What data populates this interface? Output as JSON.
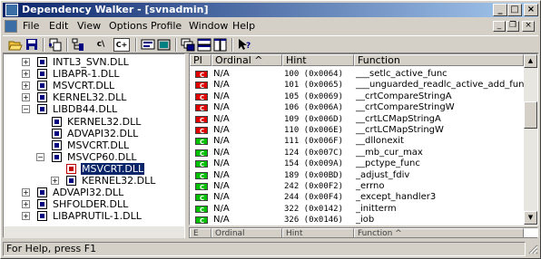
{
  "window": {
    "title": "Dependency Walker - [svnadmin]",
    "min": "_",
    "max": "□",
    "close": "×"
  },
  "menubar": {
    "items": [
      "File",
      "Edit",
      "View",
      "Options",
      "Profile",
      "Window",
      "Help"
    ],
    "mdi_min": "_",
    "mdi_restore": "❐",
    "mdi_close": "×"
  },
  "toolbar": {
    "c_label": "c\\",
    "cpp_label": "C+"
  },
  "tree": {
    "items": [
      {
        "label": "INTL3_SVN.DLL",
        "expander": "+",
        "depth": 0,
        "style": "normal",
        "selected": false
      },
      {
        "label": "LIBAPR-1.DLL",
        "expander": "+",
        "depth": 0,
        "style": "normal",
        "selected": false
      },
      {
        "label": "MSVCRT.DLL",
        "expander": "+",
        "depth": 0,
        "style": "normal",
        "selected": false
      },
      {
        "label": "KERNEL32.DLL",
        "expander": "+",
        "depth": 0,
        "style": "normal",
        "selected": false
      },
      {
        "label": "LIBDB44.DLL",
        "expander": "−",
        "depth": 0,
        "style": "normal",
        "selected": false
      },
      {
        "label": "KERNEL32.DLL",
        "expander": "",
        "depth": 1,
        "style": "normal",
        "selected": false
      },
      {
        "label": "ADVAPI32.DLL",
        "expander": "",
        "depth": 1,
        "style": "normal",
        "selected": false
      },
      {
        "label": "MSVCRT.DLL",
        "expander": "",
        "depth": 1,
        "style": "normal",
        "selected": false
      },
      {
        "label": "MSVCP60.DLL",
        "expander": "−",
        "depth": 1,
        "style": "normal",
        "selected": false
      },
      {
        "label": "MSVCRT.DLL",
        "expander": "",
        "depth": 2,
        "style": "red",
        "selected": true
      },
      {
        "label": "KERNEL32.DLL",
        "expander": "+",
        "depth": 2,
        "style": "normal",
        "selected": false
      },
      {
        "label": "ADVAPI32.DLL",
        "expander": "+",
        "depth": 0,
        "style": "normal",
        "selected": false
      },
      {
        "label": "SHFOLDER.DLL",
        "expander": "+",
        "depth": 0,
        "style": "normal",
        "selected": false
      },
      {
        "label": "LIBAPRUTIL-1.DLL",
        "expander": "+",
        "depth": 0,
        "style": "normal",
        "selected": false
      }
    ]
  },
  "list": {
    "columns": [
      "PI",
      "Ordinal ^",
      "Hint",
      "Function"
    ],
    "rows": [
      {
        "pi": "red",
        "ordinal": "N/A",
        "hint": "100 (0x0064)",
        "function": "___setlc_active_func"
      },
      {
        "pi": "red",
        "ordinal": "N/A",
        "hint": "101 (0x0065)",
        "function": "___unguarded_readlc_active_add_func"
      },
      {
        "pi": "red",
        "ordinal": "N/A",
        "hint": "105 (0x0069)",
        "function": "__crtCompareStringA"
      },
      {
        "pi": "red",
        "ordinal": "N/A",
        "hint": "106 (0x006A)",
        "function": "__crtCompareStringW"
      },
      {
        "pi": "red",
        "ordinal": "N/A",
        "hint": "109 (0x006D)",
        "function": "__crtLCMapStringA"
      },
      {
        "pi": "red",
        "ordinal": "N/A",
        "hint": "110 (0x006E)",
        "function": "__crtLCMapStringW"
      },
      {
        "pi": "green",
        "ordinal": "N/A",
        "hint": "111 (0x006F)",
        "function": "__dllonexit"
      },
      {
        "pi": "green",
        "ordinal": "N/A",
        "hint": "124 (0x007C)",
        "function": "__mb_cur_max"
      },
      {
        "pi": "green",
        "ordinal": "N/A",
        "hint": "154 (0x009A)",
        "function": "__pctype_func"
      },
      {
        "pi": "green",
        "ordinal": "N/A",
        "hint": "189 (0x00BD)",
        "function": "_adjust_fdiv"
      },
      {
        "pi": "green",
        "ordinal": "N/A",
        "hint": "242 (0x00F2)",
        "function": "_errno"
      },
      {
        "pi": "green",
        "ordinal": "N/A",
        "hint": "244 (0x00F4)",
        "function": "_except_handler3"
      },
      {
        "pi": "green",
        "ordinal": "N/A",
        "hint": "322 (0x0142)",
        "function": "_initterm"
      },
      {
        "pi": "green",
        "ordinal": "N/A",
        "hint": "326 (0x0146)",
        "function": "_iob"
      }
    ],
    "pi_glyph": "C"
  },
  "lower_list": {
    "columns": [
      "E",
      "Ordinal",
      "Hint",
      "Function ^"
    ]
  },
  "scroll": {
    "up": "▲",
    "down": "▼"
  },
  "status": {
    "text": "For Help, press F1"
  }
}
